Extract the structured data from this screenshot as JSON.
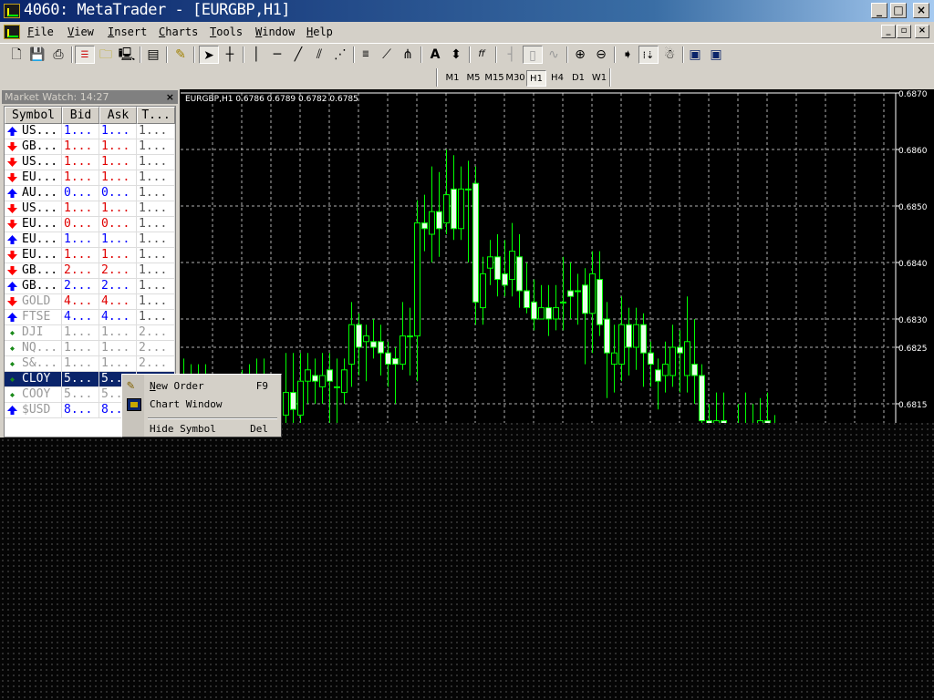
{
  "window": {
    "title": "4060: MetaTrader - [EURGBP,H1]",
    "buttons": [
      "_",
      "□",
      "×"
    ],
    "mdi_buttons": [
      "_",
      "▫",
      "×"
    ]
  },
  "menu": [
    {
      "label": "File",
      "u": "F"
    },
    {
      "label": "View",
      "u": "V"
    },
    {
      "label": "Insert",
      "u": "I"
    },
    {
      "label": "Charts",
      "u": "C"
    },
    {
      "label": "Tools",
      "u": "T"
    },
    {
      "label": "Window",
      "u": "W"
    },
    {
      "label": "Help",
      "u": "H"
    }
  ],
  "toolbar": {
    "icons": [
      "new-chart",
      "save",
      "print",
      "market-watch",
      "navigator",
      "terminal",
      "strategy-tester",
      "new-order",
      "cursor",
      "crosshair",
      "vertical-line",
      "horizontal-line",
      "trendline",
      "channel",
      "fibonacci",
      "fib-fan",
      "andrews-pitchfork",
      "text",
      "arrows",
      "periods",
      "bar-chart",
      "candlesticks",
      "line-chart",
      "zoom-in",
      "zoom-out",
      "auto-scroll",
      "chart-shift",
      "expert-advisors",
      "tile-window",
      "cascade-window"
    ]
  },
  "timeframes": {
    "items": [
      "M1",
      "M5",
      "M15",
      "M30",
      "H1",
      "H4",
      "D1",
      "W1"
    ],
    "active": "H1"
  },
  "market_watch": {
    "title": "Market Watch: 14:27",
    "close": "×",
    "columns": [
      "Symbol",
      "Bid",
      "Ask",
      "T..."
    ],
    "rows": [
      {
        "symbol": "US...",
        "bid": "1...",
        "ask": "1...",
        "time": "1...",
        "dir": "up"
      },
      {
        "symbol": "GB...",
        "bid": "1...",
        "ask": "1...",
        "time": "1...",
        "dir": "down"
      },
      {
        "symbol": "US...",
        "bid": "1...",
        "ask": "1...",
        "time": "1...",
        "dir": "down"
      },
      {
        "symbol": "EU...",
        "bid": "1...",
        "ask": "1...",
        "time": "1...",
        "dir": "down"
      },
      {
        "symbol": "AU...",
        "bid": "0...",
        "ask": "0...",
        "time": "1...",
        "dir": "up"
      },
      {
        "symbol": "US...",
        "bid": "1...",
        "ask": "1...",
        "time": "1...",
        "dir": "down"
      },
      {
        "symbol": "EU...",
        "bid": "0...",
        "ask": "0...",
        "time": "1...",
        "dir": "down"
      },
      {
        "symbol": "EU...",
        "bid": "1...",
        "ask": "1...",
        "time": "1...",
        "dir": "up"
      },
      {
        "symbol": "EU...",
        "bid": "1...",
        "ask": "1...",
        "time": "1...",
        "dir": "down"
      },
      {
        "symbol": "GB...",
        "bid": "2...",
        "ask": "2...",
        "time": "1...",
        "dir": "down"
      },
      {
        "symbol": "GB...",
        "bid": "2...",
        "ask": "2...",
        "time": "1...",
        "dir": "up"
      },
      {
        "symbol": "GOLD",
        "bid": "4...",
        "ask": "4...",
        "time": "1...",
        "dir": "down",
        "dim": true
      },
      {
        "symbol": "FTSE",
        "bid": "4...",
        "ask": "4...",
        "time": "1...",
        "dir": "up",
        "dim": true
      },
      {
        "symbol": "DJI",
        "bid": "1...",
        "ask": "1...",
        "time": "2...",
        "dir": "none",
        "dim": true
      },
      {
        "symbol": "NQ...",
        "bid": "1...",
        "ask": "1...",
        "time": "2...",
        "dir": "none",
        "dim": true
      },
      {
        "symbol": "S&...",
        "bid": "1...",
        "ask": "1...",
        "time": "2...",
        "dir": "none",
        "dim": true
      },
      {
        "symbol": "CLOY",
        "bid": "5...",
        "ask": "5...",
        "time": "",
        "dir": "none",
        "selected": true
      },
      {
        "symbol": "COOY",
        "bid": "5...",
        "ask": "5...",
        "time": "",
        "dir": "none",
        "dim": true
      },
      {
        "symbol": "$USD",
        "bid": "8...",
        "ask": "8...",
        "time": "",
        "dir": "up",
        "dim": true
      }
    ]
  },
  "context_menu": {
    "items": [
      {
        "label": "New Order",
        "u": "N",
        "shortcut": "F9",
        "icon": "new-order"
      },
      {
        "label": "Chart Window",
        "u": "h",
        "shortcut": "",
        "icon": "chart-window"
      },
      {
        "label": "Hide Symbol",
        "u": "S",
        "shortcut": "Del",
        "icon": ""
      }
    ]
  },
  "colors": {
    "up": "#0000ff",
    "down": "#e00000",
    "dim": "#999999",
    "candle": "#00ff00",
    "grid": "#c0c0c0"
  },
  "chart_data": {
    "type": "candlestick",
    "title": "EURGBP,H1  0.6786 0.6789 0.6782 0.6785",
    "ylim": [
      0.68118,
      0.687
    ],
    "y_ticks": [
      "0.6870",
      "0.6860",
      "0.6850",
      "0.6840",
      "0.6830",
      "0.6825",
      "0.6815"
    ],
    "grid": true,
    "candles": [
      [
        0.6819,
        0.6823,
        0.6812,
        0.6818
      ],
      [
        0.6818,
        0.6822,
        0.6813,
        0.682
      ],
      [
        0.682,
        0.6822,
        0.6814,
        0.6817
      ],
      [
        0.6817,
        0.6822,
        0.6812,
        0.6816
      ],
      [
        0.6816,
        0.682,
        0.6811,
        0.6815
      ],
      [
        0.6815,
        0.6819,
        0.681,
        0.6814
      ],
      [
        0.6814,
        0.6818,
        0.6809,
        0.6816
      ],
      [
        0.6816,
        0.682,
        0.6811,
        0.6817
      ],
      [
        0.6817,
        0.6821,
        0.6812,
        0.6818
      ],
      [
        0.6818,
        0.6822,
        0.6813,
        0.682
      ],
      [
        0.682,
        0.6823,
        0.6814,
        0.6818
      ],
      [
        0.6818,
        0.6823,
        0.6812,
        0.6815
      ],
      [
        0.6815,
        0.6818,
        0.681,
        0.6813
      ],
      [
        0.6813,
        0.6817,
        0.6809,
        0.6816
      ],
      [
        0.6813,
        0.6824,
        0.6808,
        0.6817
      ],
      [
        0.6817,
        0.6824,
        0.6808,
        0.6814
      ],
      [
        0.6813,
        0.6824,
        0.6807,
        0.6819
      ],
      [
        0.6819,
        0.6824,
        0.6815,
        0.6821
      ],
      [
        0.682,
        0.6823,
        0.6815,
        0.6819
      ],
      [
        0.6818,
        0.6824,
        0.6815,
        0.682
      ],
      [
        0.6821,
        0.6824,
        0.681,
        0.6819
      ],
      [
        0.6818,
        0.6823,
        0.681,
        0.6818
      ],
      [
        0.6817,
        0.6823,
        0.6815,
        0.6821
      ],
      [
        0.6822,
        0.6833,
        0.6818,
        0.6829
      ],
      [
        0.6829,
        0.6831,
        0.682,
        0.6825
      ],
      [
        0.6826,
        0.6829,
        0.6819,
        0.6827
      ],
      [
        0.6826,
        0.683,
        0.6823,
        0.6825
      ],
      [
        0.6826,
        0.6829,
        0.682,
        0.6824
      ],
      [
        0.6824,
        0.6826,
        0.6818,
        0.6822
      ],
      [
        0.6823,
        0.6825,
        0.6815,
        0.6822
      ],
      [
        0.6822,
        0.6833,
        0.6821,
        0.6827
      ],
      [
        0.6827,
        0.6832,
        0.682,
        0.6827
      ],
      [
        0.6827,
        0.6851,
        0.6819,
        0.6847
      ],
      [
        0.6847,
        0.6852,
        0.6842,
        0.6846
      ],
      [
        0.6845,
        0.6857,
        0.684,
        0.6849
      ],
      [
        0.6849,
        0.6856,
        0.6841,
        0.6846
      ],
      [
        0.6847,
        0.686,
        0.6845,
        0.6852
      ],
      [
        0.6853,
        0.6859,
        0.6844,
        0.6846
      ],
      [
        0.6846,
        0.6857,
        0.6844,
        0.6853
      ],
      [
        0.6853,
        0.6858,
        0.684,
        0.6853
      ],
      [
        0.6854,
        0.6857,
        0.6829,
        0.6833
      ],
      [
        0.6832,
        0.6841,
        0.6829,
        0.6838
      ],
      [
        0.6839,
        0.6844,
        0.6836,
        0.6841
      ],
      [
        0.6841,
        0.6845,
        0.6834,
        0.6837
      ],
      [
        0.6838,
        0.6844,
        0.6834,
        0.6836
      ],
      [
        0.6837,
        0.6847,
        0.6834,
        0.6842
      ],
      [
        0.6841,
        0.6845,
        0.6832,
        0.6835
      ],
      [
        0.6835,
        0.684,
        0.6831,
        0.6832
      ],
      [
        0.6833,
        0.6837,
        0.6828,
        0.683
      ],
      [
        0.683,
        0.6836,
        0.683,
        0.6832
      ],
      [
        0.6832,
        0.6836,
        0.6827,
        0.683
      ],
      [
        0.683,
        0.6836,
        0.6828,
        0.6832
      ],
      [
        0.6833,
        0.6841,
        0.6828,
        0.6833
      ],
      [
        0.6835,
        0.684,
        0.683,
        0.6834
      ],
      [
        0.6835,
        0.6838,
        0.6829,
        0.6835
      ],
      [
        0.6836,
        0.6839,
        0.6822,
        0.6831
      ],
      [
        0.6831,
        0.6842,
        0.6824,
        0.6838
      ],
      [
        0.6837,
        0.6842,
        0.6827,
        0.6829
      ],
      [
        0.683,
        0.6833,
        0.6816,
        0.6824
      ],
      [
        0.6822,
        0.6829,
        0.6817,
        0.6824
      ],
      [
        0.6822,
        0.6834,
        0.6819,
        0.6829
      ],
      [
        0.6829,
        0.6832,
        0.682,
        0.6825
      ],
      [
        0.6825,
        0.6832,
        0.6821,
        0.6829
      ],
      [
        0.6829,
        0.6831,
        0.6818,
        0.6824
      ],
      [
        0.6824,
        0.6826,
        0.6818,
        0.6822
      ],
      [
        0.6821,
        0.6823,
        0.6814,
        0.6819
      ],
      [
        0.682,
        0.6826,
        0.6817,
        0.6822
      ],
      [
        0.682,
        0.6829,
        0.6818,
        0.6825
      ],
      [
        0.6825,
        0.6828,
        0.6817,
        0.6824
      ],
      [
        0.682,
        0.6834,
        0.6817,
        0.6826
      ],
      [
        0.6822,
        0.683,
        0.6815,
        0.682
      ],
      [
        0.682,
        0.6822,
        0.681,
        0.6812
      ],
      [
        0.6812,
        0.6815,
        0.6808,
        0.681
      ],
      [
        0.681,
        0.6817,
        0.6808,
        0.6812
      ],
      [
        0.6812,
        0.6817,
        0.6808,
        0.681
      ],
      [
        0.681,
        0.6811,
        0.6808,
        0.6809
      ],
      [
        0.681,
        0.6815,
        0.6808,
        0.6811
      ],
      [
        0.6811,
        0.6817,
        0.6808,
        0.681
      ],
      [
        0.681,
        0.6815,
        0.6808,
        0.6811
      ],
      [
        0.6811,
        0.6816,
        0.6808,
        0.6812
      ],
      [
        0.6812,
        0.6817,
        0.6808,
        0.6811
      ],
      [
        0.6811,
        0.6813,
        0.6808,
        0.681
      ]
    ]
  }
}
